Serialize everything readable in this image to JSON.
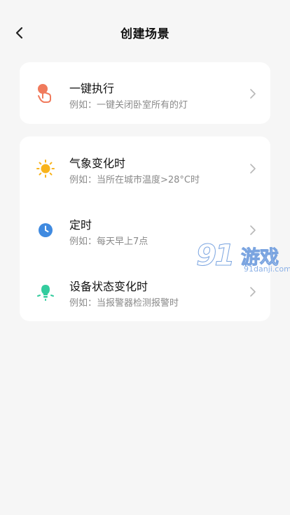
{
  "header": {
    "title": "创建场景"
  },
  "card1": {
    "items": [
      {
        "title": "一键执行",
        "subtitle": "例如：一键关闭卧室所有的灯",
        "icon": "hand-tap-icon"
      }
    ]
  },
  "card2": {
    "items": [
      {
        "title": "气象变化时",
        "subtitle": "例如：当所在城市温度>28°C时",
        "icon": "sun-icon"
      },
      {
        "title": "定时",
        "subtitle": "例如：每天早上7点",
        "icon": "clock-icon"
      },
      {
        "title": "设备状态变化时",
        "subtitle": "例如：当报警器检测报警时",
        "icon": "bulb-icon"
      }
    ]
  },
  "watermark": {
    "number": "91",
    "brand": "游戏",
    "url": "91danji.com"
  },
  "colors": {
    "hand": "#f07a5c",
    "sun": "#f8b31c",
    "clock": "#3f8ae0",
    "bulb": "#33cc9e"
  }
}
